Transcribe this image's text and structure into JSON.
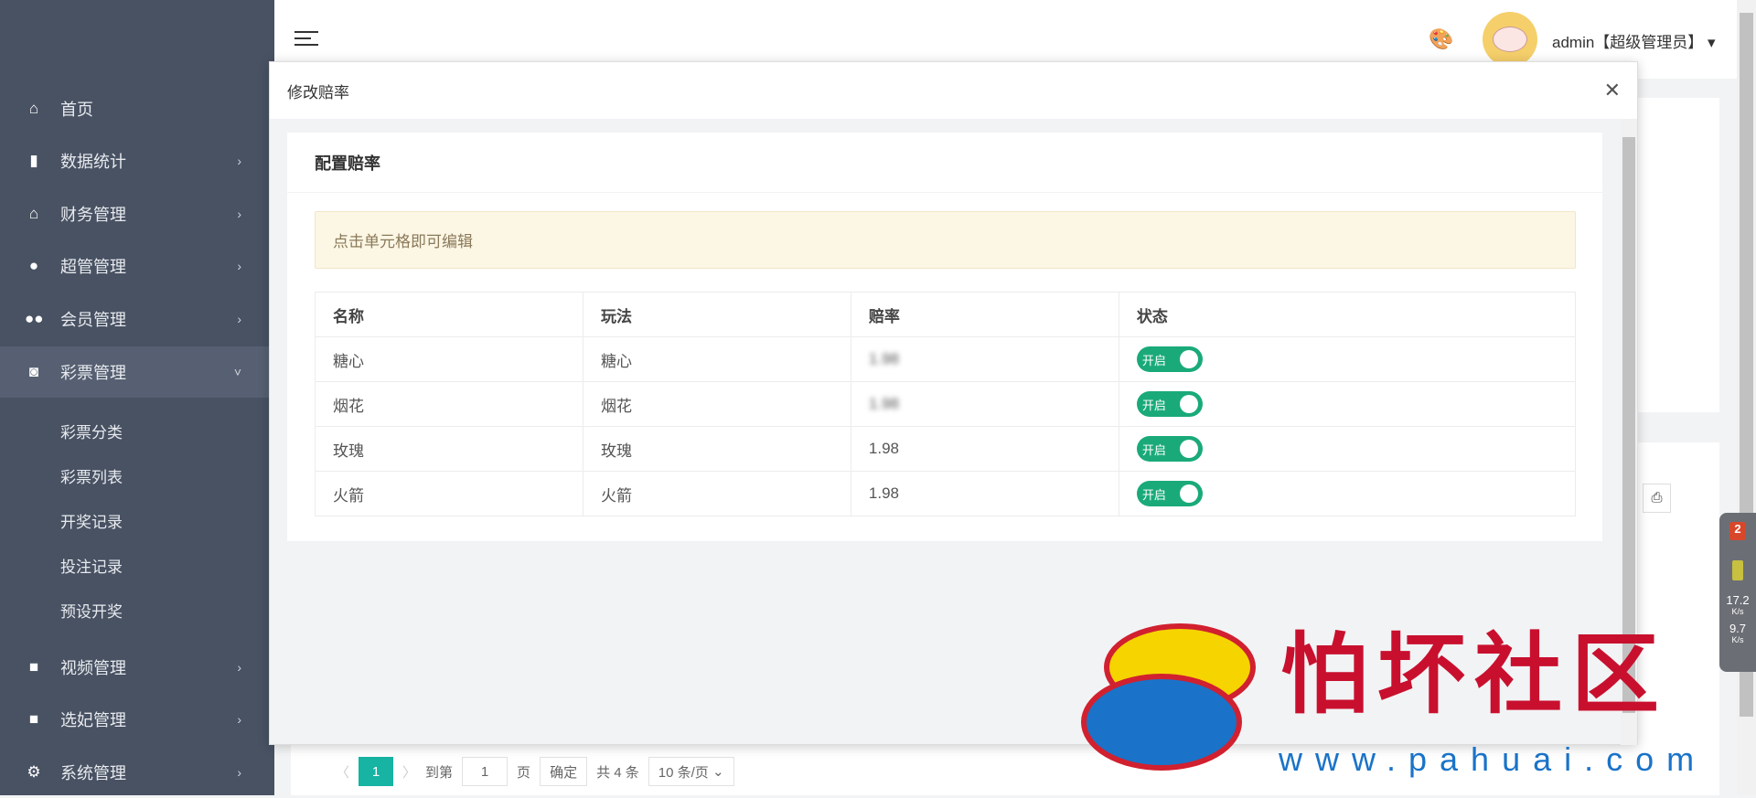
{
  "sidebar": {
    "items": [
      {
        "label": "首页",
        "icon": "home-icon"
      },
      {
        "label": "数据统计",
        "icon": "bar-chart-icon"
      },
      {
        "label": "财务管理",
        "icon": "bank-icon"
      },
      {
        "label": "超管管理",
        "icon": "user-icon"
      },
      {
        "label": "会员管理",
        "icon": "users-icon"
      },
      {
        "label": "彩票管理",
        "icon": "gamepad-icon"
      },
      {
        "label": "视频管理",
        "icon": "video-icon"
      },
      {
        "label": "选妃管理",
        "icon": "video-icon"
      },
      {
        "label": "系统管理",
        "icon": "gear-icon"
      }
    ],
    "sub_items": [
      "彩票分类",
      "彩票列表",
      "开奖记录",
      "投注记录",
      "预设开奖"
    ]
  },
  "header": {
    "user": "admin【超级管理员】"
  },
  "modal": {
    "title": "修改赔率",
    "card_title": "配置赔率",
    "alert": "点击单元格即可编辑",
    "columns": [
      "名称",
      "玩法",
      "赔率",
      "状态"
    ],
    "rows": [
      {
        "name": "糖心",
        "play": "糖心",
        "odds": "1.98",
        "status": "开启",
        "odds_blurred": true
      },
      {
        "name": "烟花",
        "play": "烟花",
        "odds": "1.98",
        "status": "开启",
        "odds_blurred": true
      },
      {
        "name": "玫瑰",
        "play": "玫瑰",
        "odds": "1.98",
        "status": "开启"
      },
      {
        "name": "火箭",
        "play": "火箭",
        "odds": "1.98",
        "status": "开启"
      }
    ]
  },
  "pagination": {
    "current": "1",
    "goto_label": "到第",
    "goto_value": "1",
    "page_label": "页",
    "confirm": "确定",
    "total": "共 4 条",
    "page_size": "10 条/页"
  },
  "widget": {
    "badge": "2",
    "up": "17.2",
    "up_unit": "K/s",
    "down": "9.7",
    "down_unit": "K/s"
  },
  "watermark": {
    "title": "怕坏社区",
    "url": "www.pahuai.com"
  },
  "colors": {
    "sidebar": "#485263",
    "accent": "#17b3a3",
    "switch_on": "#1aaa79"
  }
}
